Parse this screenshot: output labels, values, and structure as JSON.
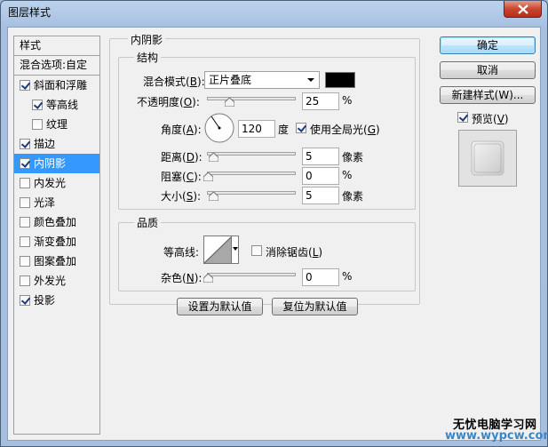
{
  "window": {
    "title": "图层样式"
  },
  "stylelist": {
    "header": "样式",
    "blend_options": "混合选项:自定",
    "items": [
      {
        "label": "斜面和浮雕",
        "checked": true,
        "indent": false,
        "selected": false
      },
      {
        "label": "等高线",
        "checked": true,
        "indent": true,
        "selected": false
      },
      {
        "label": "纹理",
        "checked": false,
        "indent": true,
        "selected": false
      },
      {
        "label": "描边",
        "checked": true,
        "indent": false,
        "selected": false
      },
      {
        "label": "内阴影",
        "checked": true,
        "indent": false,
        "selected": true
      },
      {
        "label": "内发光",
        "checked": false,
        "indent": false,
        "selected": false
      },
      {
        "label": "光泽",
        "checked": false,
        "indent": false,
        "selected": false
      },
      {
        "label": "颜色叠加",
        "checked": false,
        "indent": false,
        "selected": false
      },
      {
        "label": "渐变叠加",
        "checked": false,
        "indent": false,
        "selected": false
      },
      {
        "label": "图案叠加",
        "checked": false,
        "indent": false,
        "selected": false
      },
      {
        "label": "外发光",
        "checked": false,
        "indent": false,
        "selected": false
      },
      {
        "label": "投影",
        "checked": true,
        "indent": false,
        "selected": false
      }
    ]
  },
  "panel": {
    "title": "内阴影",
    "structure": {
      "title": "结构",
      "blend_mode_label": "混合模式",
      "blend_mode_key": "B",
      "blend_mode_value": "正片叠底",
      "blend_color": "#000000",
      "opacity_label": "不透明度",
      "opacity_key": "O",
      "opacity_value": "25",
      "opacity_unit": "%",
      "angle_label": "角度",
      "angle_key": "A",
      "angle_value": "120",
      "angle_unit": "度",
      "global_light_label": "使用全局光",
      "global_light_key": "G",
      "global_light_checked": true,
      "distance_label": "距离",
      "distance_key": "D",
      "distance_value": "5",
      "distance_unit": "像素",
      "choke_label": "阻塞",
      "choke_key": "C",
      "choke_value": "0",
      "choke_unit": "%",
      "size_label": "大小",
      "size_key": "S",
      "size_value": "5",
      "size_unit": "像素"
    },
    "quality": {
      "title": "品质",
      "contour_label": "等高线:",
      "antialias_label": "消除锯齿",
      "antialias_key": "L",
      "antialias_checked": false,
      "noise_label": "杂色",
      "noise_key": "N",
      "noise_value": "0",
      "noise_unit": "%"
    },
    "set_default_label": "设置为默认值",
    "reset_default_label": "复位为默认值"
  },
  "buttons": {
    "ok_label": "确定",
    "cancel_label": "取消",
    "new_style_label": "新建样式(W)...",
    "preview_label": "预览",
    "preview_key": "V",
    "preview_checked": true
  },
  "watermark": {
    "line1": "无忧电脑学习网",
    "line2": "www.wypcw.com"
  }
}
